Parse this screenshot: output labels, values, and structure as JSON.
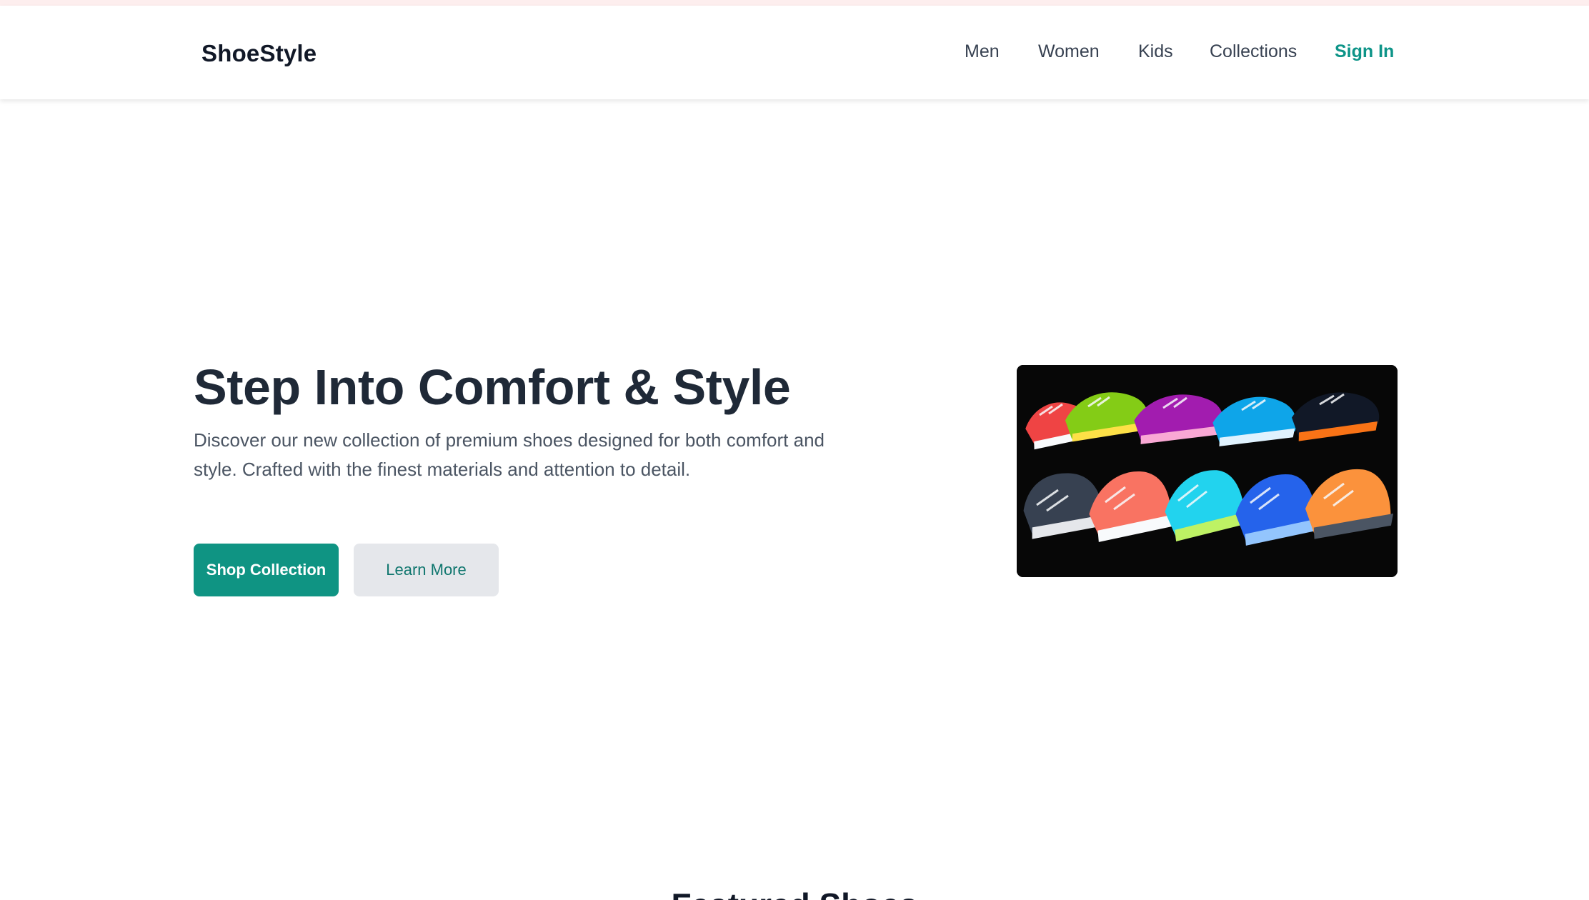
{
  "brand": {
    "name": "ShoeStyle",
    "accent_color": "#0f9483"
  },
  "nav": {
    "items": [
      {
        "label": "Men"
      },
      {
        "label": "Women"
      },
      {
        "label": "Kids"
      },
      {
        "label": "Collections"
      }
    ],
    "sign_in": "Sign In"
  },
  "hero": {
    "title": "Step Into Comfort & Style",
    "description": "Discover our new collection of premium shoes designed for both comfort and style. Crafted with the finest materials and attention to detail.",
    "primary_button": "Shop Collection",
    "secondary_button": "Learn More",
    "image_subject": "colorful running shoes"
  },
  "featured": {
    "title": "Featured Shoes"
  }
}
